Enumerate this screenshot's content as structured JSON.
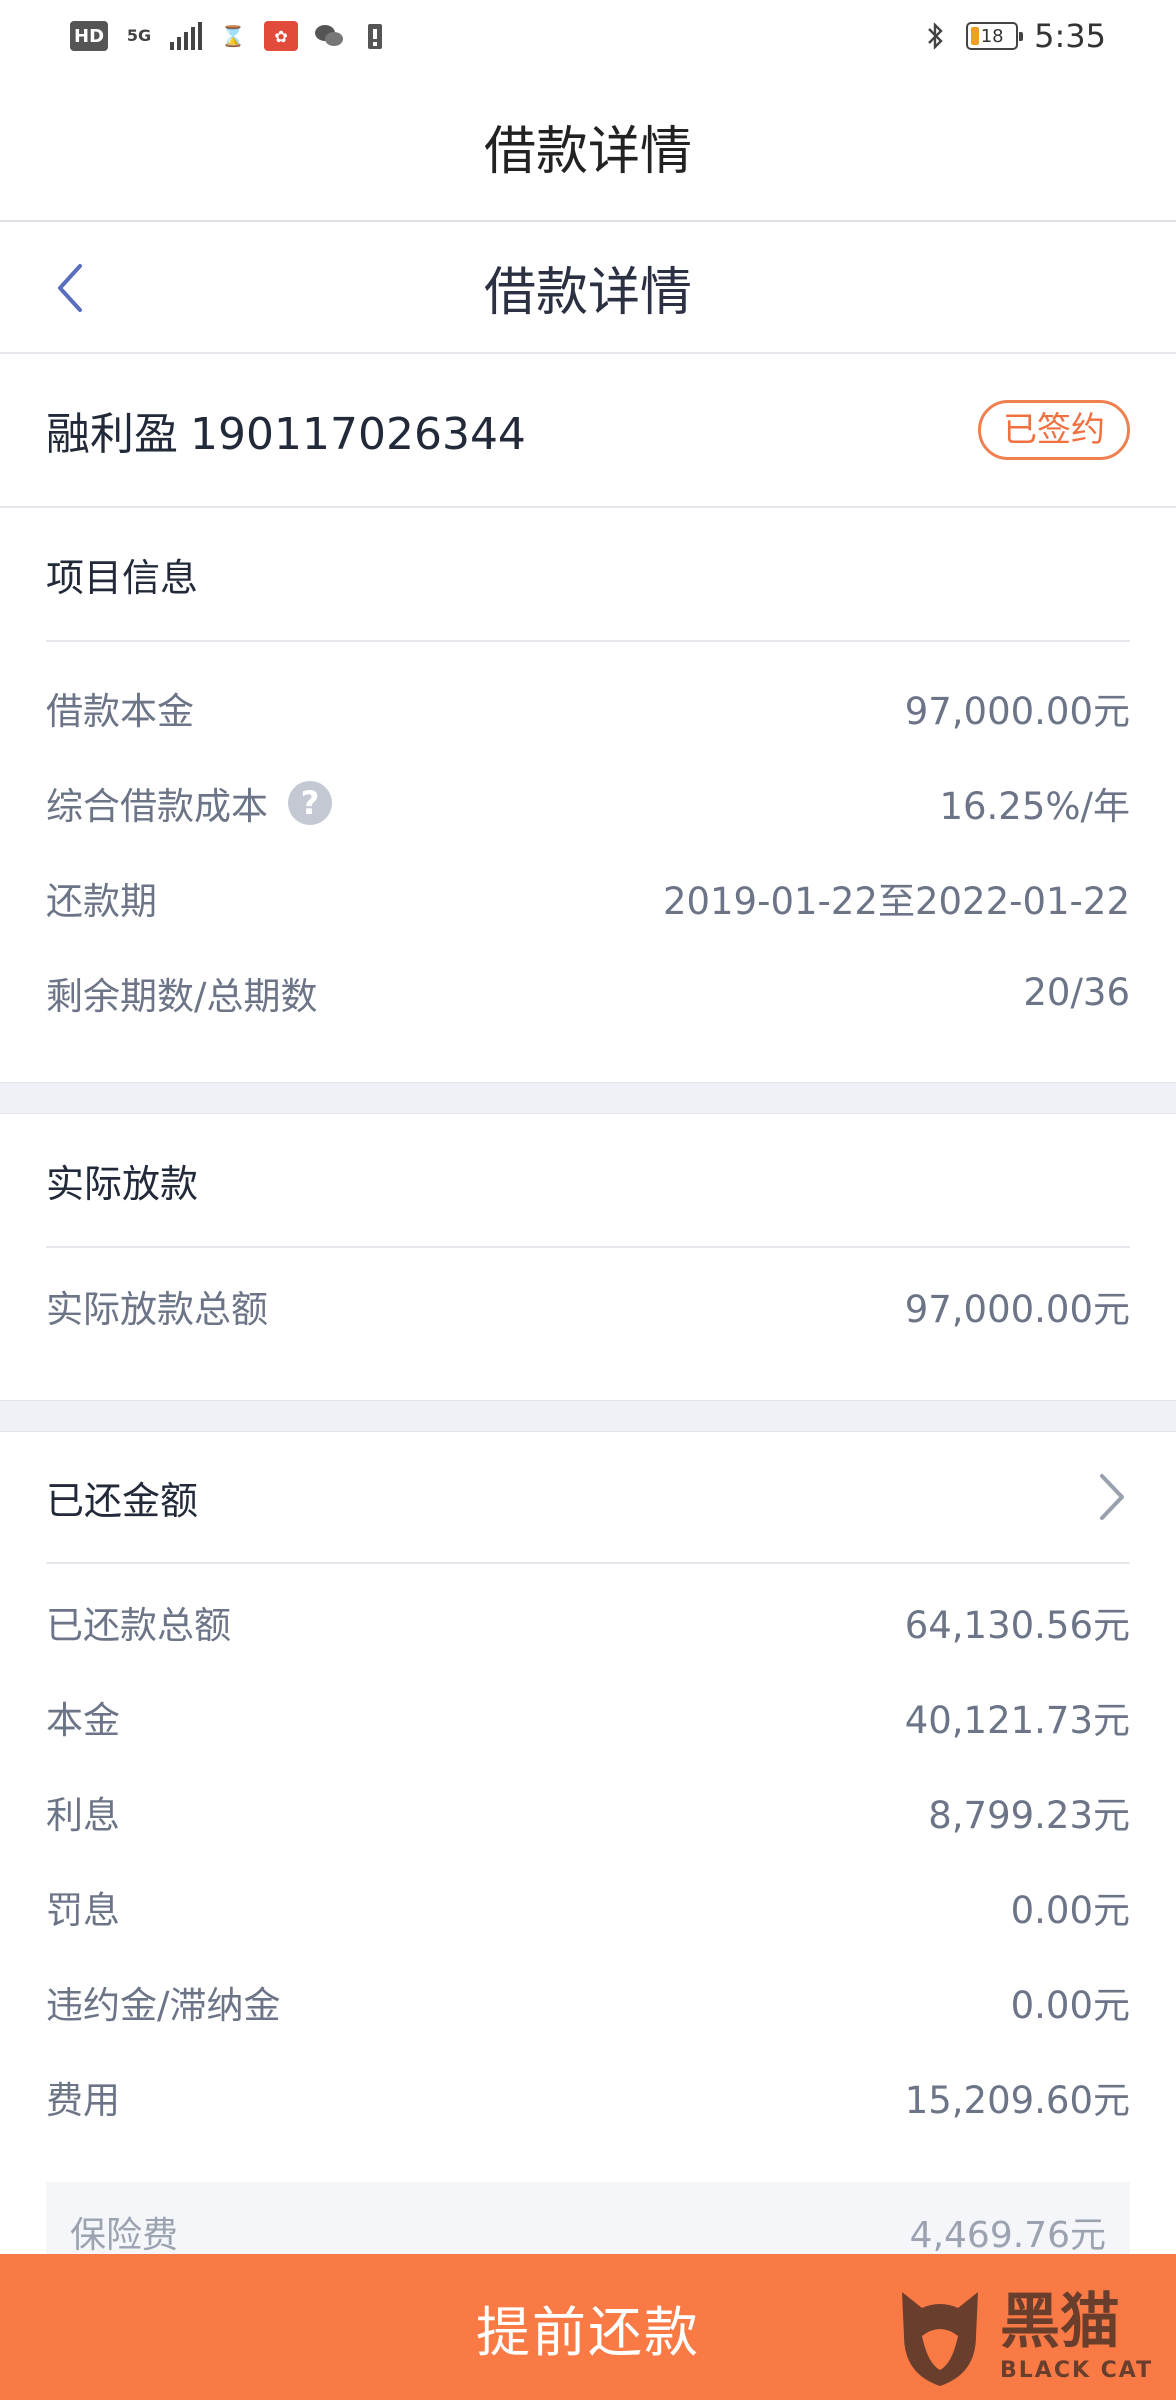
{
  "status_bar": {
    "left_icons": [
      "hd-icon",
      "5g-signal-icon",
      "signal-bars-icon",
      "hourglass-icon",
      "app-notification-icon",
      "wechat-icon",
      "alert-icon"
    ],
    "hd": "HD",
    "network": "5G",
    "battery": "18",
    "time": "5:35"
  },
  "app_header": {
    "title": "借款详情"
  },
  "nav": {
    "title": "借款详情",
    "back_icon": "chevron-left-icon"
  },
  "loan": {
    "product": "融利盈",
    "number": "190117026344",
    "status": "已签约",
    "status_color": "#f07040"
  },
  "project_info": {
    "title": "项目信息",
    "rows": [
      {
        "label": "借款本金",
        "value": "97,000.00元"
      },
      {
        "label": "综合借款成本",
        "value": "16.25%/年",
        "help": "?"
      },
      {
        "label": "还款期",
        "value": "2019-01-22至2022-01-22"
      },
      {
        "label": "剩余期数/总期数",
        "value": "20/36"
      }
    ]
  },
  "disbursement": {
    "title": "实际放款",
    "rows": [
      {
        "label": "实际放款总额",
        "value": "97,000.00元"
      }
    ]
  },
  "repaid": {
    "title": "已还金额",
    "rows": [
      {
        "label": "已还款总额",
        "value": "64,130.56元"
      },
      {
        "label": "本金",
        "value": "40,121.73元"
      },
      {
        "label": "利息",
        "value": "8,799.23元"
      },
      {
        "label": "罚息",
        "value": "0.00元"
      },
      {
        "label": "违约金/滞纳金",
        "value": "0.00元"
      },
      {
        "label": "费用",
        "value": "15,209.60元"
      }
    ],
    "sub_row": {
      "label": "保险费",
      "value": "4,469.76元"
    }
  },
  "bottom": {
    "prepay_label": "提前还款",
    "accent": "#fa7a45"
  },
  "watermark": {
    "cn": "黑猫",
    "en": "BLACK CAT"
  }
}
